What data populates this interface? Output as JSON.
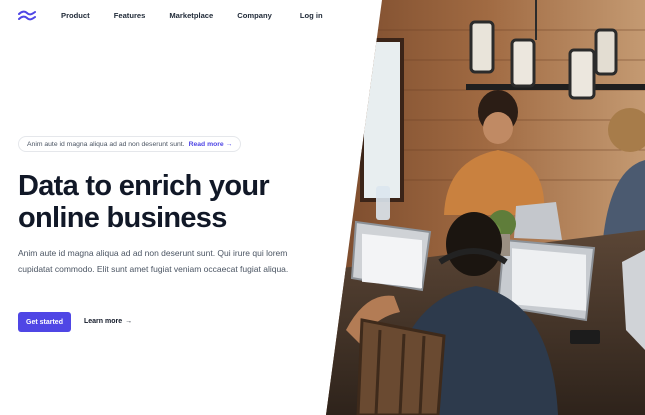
{
  "nav": {
    "logo_icon": "wave-logo-icon",
    "items": [
      "Product",
      "Features",
      "Marketplace",
      "Company"
    ],
    "login": "Log in"
  },
  "announcement": {
    "text": "Anim aute id magna aliqua ad ad non deserunt sunt.",
    "link": "Read more",
    "link_arrow": "→"
  },
  "hero": {
    "title_line1": "Data to enrich your",
    "title_line2": "online business",
    "description": "Anim aute id magna aliqua ad ad non deserunt sunt. Qui irure qui lorem cupidatat commodo. Elit sunt amet fugiat veniam occaecat fugiat aliqua.",
    "primary_cta": "Get started",
    "secondary_cta": "Learn more",
    "secondary_arrow": "→"
  },
  "colors": {
    "accent": "#4f46e5",
    "text": "#111827",
    "muted": "#4b5563"
  },
  "image": {
    "subject": "people working on laptops at a wooden table"
  }
}
